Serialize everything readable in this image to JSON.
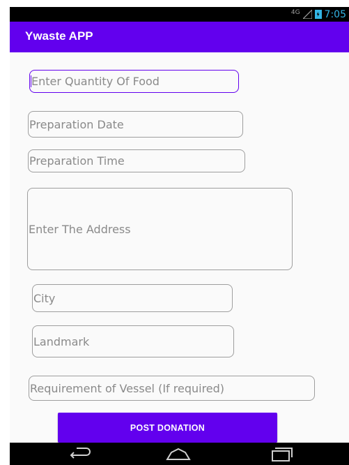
{
  "status_bar": {
    "network": "4G",
    "time": "7:05"
  },
  "app_bar": {
    "title": "Ywaste APP"
  },
  "form": {
    "quantity": {
      "placeholder": "Enter Quantity Of Food",
      "value": ""
    },
    "prep_date": {
      "placeholder": "Preparation Date",
      "value": ""
    },
    "prep_time": {
      "placeholder": "Preparation Time",
      "value": ""
    },
    "address": {
      "placeholder": "Enter The Address",
      "value": ""
    },
    "city": {
      "placeholder": "City",
      "value": ""
    },
    "landmark": {
      "placeholder": "Landmark",
      "value": ""
    },
    "vessel": {
      "placeholder": "Requirement of Vessel (If required)",
      "value": ""
    }
  },
  "post_button": {
    "label": "POST DONATION"
  },
  "nav_bar": {
    "icons": [
      "back-icon",
      "home-icon",
      "recents-icon"
    ]
  },
  "colors": {
    "primary": "#6200ee",
    "status_accent": "#33b5e5"
  }
}
